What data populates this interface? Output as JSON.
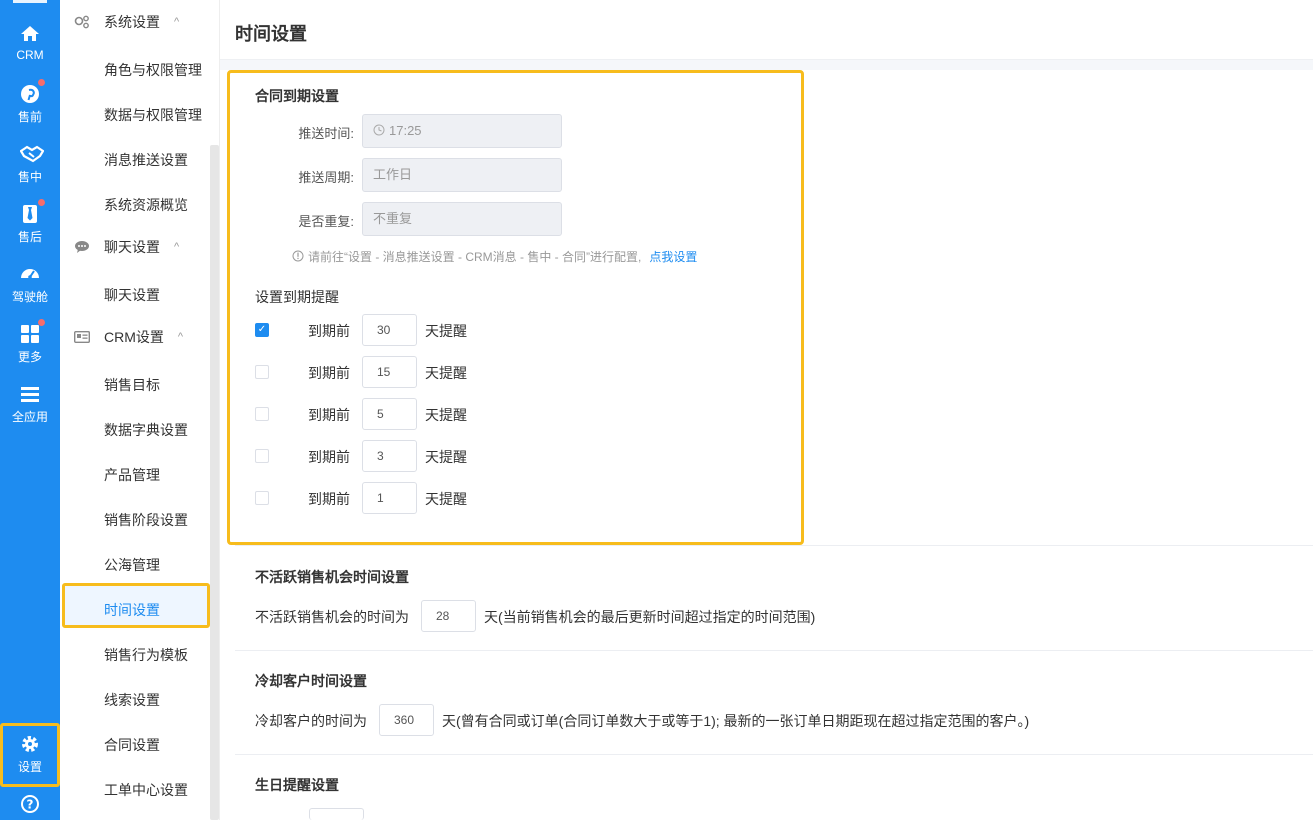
{
  "rail": {
    "items": [
      {
        "label": "CRM",
        "icon": "home-icon",
        "badge": false
      },
      {
        "label": "售前",
        "icon": "pinterest-icon",
        "badge": true
      },
      {
        "label": "售中",
        "icon": "handshake-icon",
        "badge": false
      },
      {
        "label": "售后",
        "icon": "tie-icon",
        "badge": true
      },
      {
        "label": "驾驶舱",
        "icon": "dashboard-icon",
        "badge": false
      },
      {
        "label": "更多",
        "icon": "grid-icon",
        "badge": true
      },
      {
        "label": "全应用",
        "icon": "menu-icon",
        "badge": false
      },
      {
        "label": "设置",
        "icon": "gear-icon",
        "badge": false
      },
      {
        "label": "帮助",
        "icon": "help-icon",
        "badge": false
      }
    ]
  },
  "sidebar": {
    "groups": [
      {
        "label": "系统设置",
        "icon": "gears-icon"
      },
      {
        "label": "聊天设置",
        "icon": "chat-icon"
      },
      {
        "label": "CRM设置",
        "icon": "id-card-icon"
      }
    ],
    "items": [
      "角色与权限管理",
      "数据与权限管理",
      "消息推送设置",
      "系统资源概览",
      "聊天设置",
      "销售目标",
      "数据字典设置",
      "产品管理",
      "销售阶段设置",
      "公海管理",
      "时间设置",
      "销售行为模板",
      "线索设置",
      "合同设置",
      "工单中心设置"
    ]
  },
  "page": {
    "title": "时间设置"
  },
  "contract": {
    "title": "合同到期设置",
    "push_time_label": "推送时间:",
    "push_time_value": "17:25",
    "push_cycle_label": "推送周期:",
    "push_cycle_value": "工作日",
    "repeat_label": "是否重复:",
    "repeat_value": "不重复",
    "hint": "请前往“设置 - 消息推送设置 - CRM消息 - 售中 - 合同”进行配置,",
    "hint_link": "点我设置",
    "reminder_title": "设置到期提醒",
    "reminder_prefix": "到期前",
    "reminder_suffix": "天提醒",
    "reminders": [
      {
        "days": "30",
        "checked": true
      },
      {
        "days": "15",
        "checked": false
      },
      {
        "days": "5",
        "checked": false
      },
      {
        "days": "3",
        "checked": false
      },
      {
        "days": "1",
        "checked": false
      }
    ]
  },
  "inactive": {
    "title": "不活跃销售机会时间设置",
    "prefix": "不活跃销售机会的时间为",
    "value": "28",
    "suffix": "天(当前销售机会的最后更新时间超过指定的时间范围)"
  },
  "cooling": {
    "title": "冷却客户时间设置",
    "prefix": "冷却客户的时间为",
    "value": "360",
    "suffix": "天(曾有合同或订单(合同订单数大于或等于1); 最新的一张订单日期距现在超过指定范围的客户。)"
  },
  "birthday": {
    "title": "生日提醒设置"
  },
  "colors": {
    "accent": "#1e8cf0",
    "highlight": "#f7bc1c",
    "badge": "#f56c6c"
  }
}
